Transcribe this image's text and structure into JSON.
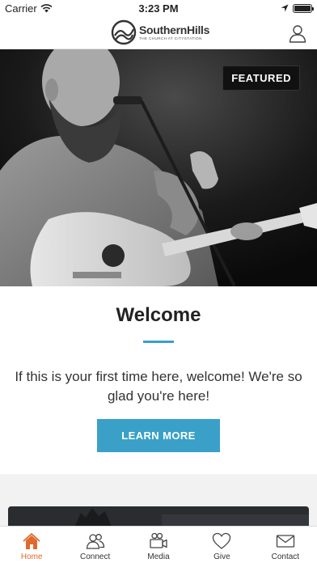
{
  "status_bar": {
    "carrier": "Carrier",
    "time": "3:23 PM",
    "battery_percent": 100
  },
  "header": {
    "logo_name": "SouthernHills",
    "logo_subtitle": "THE CHURCH AT CITYSTATION",
    "profile_icon": "user-icon"
  },
  "hero": {
    "badge": "FEATURED"
  },
  "welcome": {
    "title": "Welcome",
    "text": "If this is your first time here, welcome! We're so glad you're here!",
    "button_label": "LEARN MORE"
  },
  "tabs": [
    {
      "label": "Home",
      "icon": "home-icon",
      "active": true
    },
    {
      "label": "Connect",
      "icon": "people-icon",
      "active": false
    },
    {
      "label": "Media",
      "icon": "video-camera-icon",
      "active": false
    },
    {
      "label": "Give",
      "icon": "heart-icon",
      "active": false
    },
    {
      "label": "Contact",
      "icon": "envelope-icon",
      "active": false
    }
  ],
  "colors": {
    "accent": "#3aa0c8",
    "active_tab": "#e06a2c"
  }
}
